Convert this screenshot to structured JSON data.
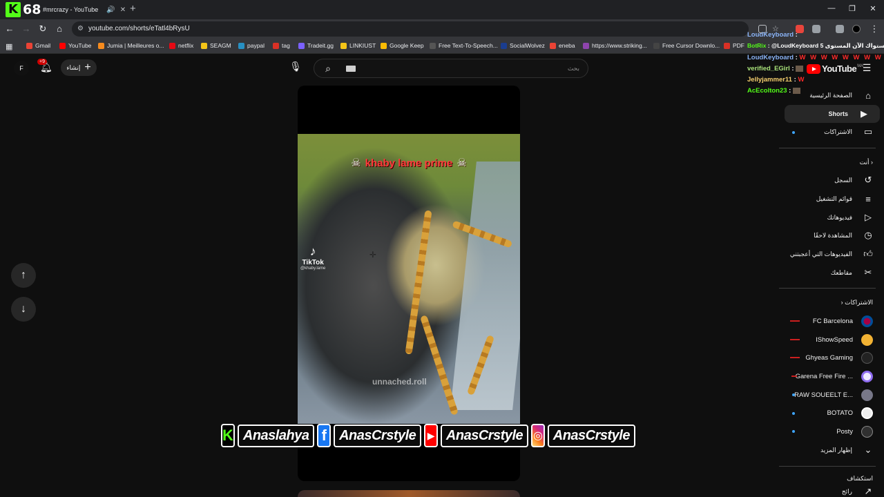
{
  "browser": {
    "kick_count": "68",
    "tab_title": "#mrcrazy - YouTube",
    "new_tab_label": "+",
    "url": "youtube.com/shorts/eTatl4bRysU",
    "bookmarks": [
      {
        "label": "Gmail",
        "color": "#ea4335"
      },
      {
        "label": "YouTube",
        "color": "#ff0000"
      },
      {
        "label": "Jumia | Meilleures o...",
        "color": "#f68b1e"
      },
      {
        "label": "netflix",
        "color": "#e50914"
      },
      {
        "label": "SEAGM",
        "color": "#f5c518"
      },
      {
        "label": "paypal",
        "color": "#2790c3"
      },
      {
        "label": "tag",
        "color": "#d93025"
      },
      {
        "label": "Tradeit.gg",
        "color": "#7b61ff"
      },
      {
        "label": "LINKIUST",
        "color": "#f5c518"
      },
      {
        "label": "Google Keep",
        "color": "#fbbc04"
      },
      {
        "label": "Free Text-To-Speech...",
        "color": "#555555"
      },
      {
        "label": "SocialWolvez",
        "color": "#1a3d8f"
      },
      {
        "label": "eneba",
        "color": "#ea4335"
      },
      {
        "label": "https://www.striking...",
        "color": "#8e44ad"
      },
      {
        "label": "Free Cursor Downlo...",
        "color": "#444444"
      },
      {
        "label": "PDF",
        "color": "#d93025"
      }
    ]
  },
  "youtube": {
    "avatar_letter": "F",
    "notif_badge": "+9",
    "create_label": "إنشاء",
    "search_placeholder": "بحث",
    "logo_text": "YouTube",
    "logo_region": "MA"
  },
  "chat": [
    {
      "user": "LoudKeyboard",
      "msg": "",
      "color": "#8ab4f8"
    },
    {
      "user": "BotRix",
      "msg": "@LoudKeyboard 5 مستواك الآن المستوى",
      "color": "#53fc18"
    },
    {
      "user": "LoudKeyboard",
      "msg": "W W W W W W W W W",
      "color": "#8ab4f8"
    },
    {
      "user": "verified_EGirl",
      "msg": "",
      "color": "#a9e27a"
    },
    {
      "user": "Jellyjammer11",
      "msg": "W",
      "color": "#f6d06f"
    },
    {
      "user": "AcEcolton23",
      "msg": "",
      "color": "#53fc18"
    }
  ],
  "sidebar": {
    "main": [
      {
        "label": "الصفحة الرئيسية",
        "icon": "home-icon"
      },
      {
        "label": "Shorts",
        "icon": "shorts-icon"
      },
      {
        "label": "الاشتراكات",
        "icon": "subscriptions-icon"
      }
    ],
    "you_header": "أنت",
    "you": [
      {
        "label": "السجل",
        "icon": "history-icon"
      },
      {
        "label": "قوائم التشغيل",
        "icon": "playlists-icon"
      },
      {
        "label": "فيديوهاتك",
        "icon": "your-videos-icon"
      },
      {
        "label": "المشاهدة لاحقًا",
        "icon": "watch-later-icon"
      },
      {
        "label": "الفيديوهات التي أعجبتني",
        "icon": "liked-icon"
      },
      {
        "label": "مقاطعك",
        "icon": "clips-icon"
      }
    ],
    "subs_header": "الاشتراكات",
    "subs": [
      {
        "name": "FC Barcelona",
        "color": "#a50044"
      },
      {
        "name": "IShowSpeed",
        "color": "#f2b233"
      },
      {
        "name": "Ghyeas Gaming",
        "color": "#222222"
      },
      {
        "name": "Garena Free Fire ...",
        "color": "#8e6cf0"
      },
      {
        "name": "RAW SOUEELT E...",
        "color": "#777788"
      },
      {
        "name": "BOTATO",
        "color": "#eeeeee"
      },
      {
        "name": "Posty",
        "color": "#303030"
      }
    ],
    "show_more": "إظهار المزيد",
    "explore_header": "استكشاف",
    "explore_first": "رائج"
  },
  "video": {
    "caption": "khaby lame prime",
    "tiktok_label": "TikTok",
    "tiktok_handle": "@khaby.lame",
    "watermark": "unnached.roll"
  },
  "socials": {
    "kick": "Anaslahya",
    "facebook": "AnasCrstyle",
    "youtube": "AnasCrstyle",
    "instagram": "AnasCrstyle"
  }
}
